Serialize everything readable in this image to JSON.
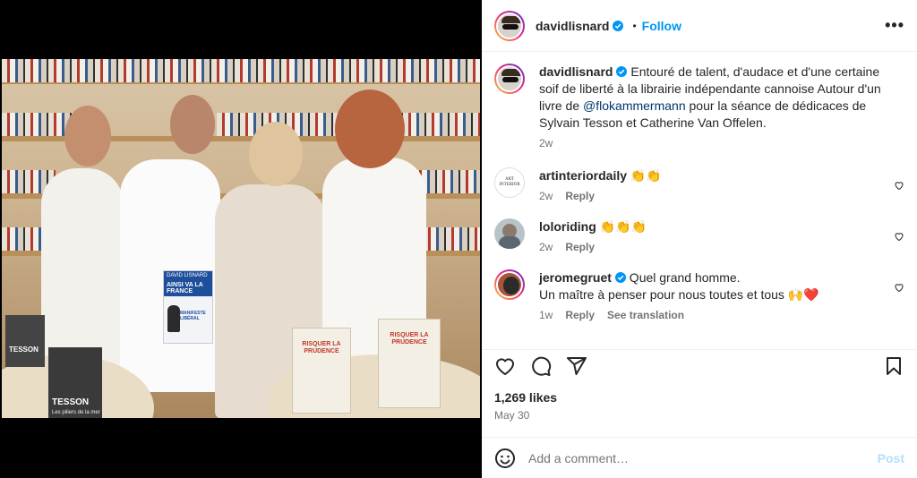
{
  "header": {
    "username": "davidlisnard",
    "separator": "•",
    "follow_label": "Follow",
    "more_label": "•••"
  },
  "photo": {
    "held_book": {
      "author": "DAVID LISNARD",
      "title": "AINSI VA LA FRANCE",
      "subtitle": "MANIFESTE LIBÉRAL"
    },
    "table_book": {
      "author": "TESSON",
      "subtitle": "Les piliers de la mer"
    },
    "shelf_book": {
      "author": "TESSON"
    },
    "stack_book_1": {
      "title": "RISQUER LA PRUDENCE"
    },
    "stack_book_2": {
      "title": "RISQUER LA PRUDENCE"
    }
  },
  "caption": {
    "username": "davidlisnard",
    "text_before": " Entouré de talent, d'audace et d'une certaine soif de liberté à la librairie indépendante cannoise Autour d'un livre de ",
    "mention": "@flokammermann",
    "text_after": " pour la séance de dédicaces de Sylvain Tesson et Catherine Van Offelen.",
    "time": "2w"
  },
  "comments": [
    {
      "username": "artinteriordaily",
      "text": " 👏👏",
      "time": "2w",
      "reply": "Reply",
      "avatar_text": "ART INTERIOR"
    },
    {
      "username": "loloriding",
      "text": " 👏👏👏",
      "time": "2w",
      "reply": "Reply"
    },
    {
      "username": "jeromegruet",
      "text": " Quel grand homme.",
      "text2": "Un maître à penser pour nous toutes et tous 🙌❤️",
      "time": "1w",
      "reply": "Reply",
      "translate": "See translation"
    }
  ],
  "stats": {
    "likes": "1,269 likes",
    "date": "May 30"
  },
  "add_comment": {
    "placeholder": "Add a comment…",
    "post_label": "Post"
  },
  "colors": {
    "accent": "#0095f6",
    "verified": "#0095f6",
    "muted": "#737373"
  }
}
